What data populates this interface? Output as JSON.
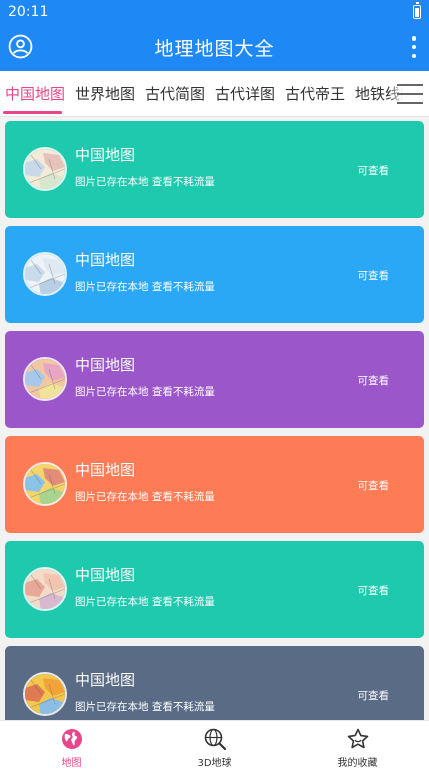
{
  "status_bar": {
    "time": "20:11"
  },
  "app_bar": {
    "title": "地理地图大全"
  },
  "tabs": [
    {
      "label": "中国地图"
    },
    {
      "label": "世界地图"
    },
    {
      "label": "古代简图"
    },
    {
      "label": "古代详图"
    },
    {
      "label": "古代帝王"
    },
    {
      "label": "地铁线路"
    }
  ],
  "colors": {
    "primary": "#1e88f5",
    "accent": "#e8458b",
    "cards": [
      "#1ec9ae",
      "#2ba8f5",
      "#9b57c9",
      "#fd7b55",
      "#1ec9ae",
      "#596b85"
    ]
  },
  "cards": [
    {
      "title": "中国地图",
      "subtitle": "图片已存在本地 查看不耗流量",
      "action": "可查看",
      "thumb_icon": "china-map-thumbnail"
    },
    {
      "title": "中国地图",
      "subtitle": "图片已存在本地 查看不耗流量",
      "action": "可查看",
      "thumb_icon": "china-map-thumbnail"
    },
    {
      "title": "中国地图",
      "subtitle": "图片已存在本地 查看不耗流量",
      "action": "可查看",
      "thumb_icon": "china-map-thumbnail"
    },
    {
      "title": "中国地图",
      "subtitle": "图片已存在本地 查看不耗流量",
      "action": "可查看",
      "thumb_icon": "china-map-thumbnail"
    },
    {
      "title": "中国地图",
      "subtitle": "图片已存在本地 查看不耗流量",
      "action": "可查看",
      "thumb_icon": "china-map-thumbnail"
    },
    {
      "title": "中国地图",
      "subtitle": "图片已存在本地 查看不耗流量",
      "action": "可查看",
      "thumb_icon": "china-map-thumbnail"
    }
  ],
  "bottom_nav": [
    {
      "label": "地图",
      "icon": "globe-icon"
    },
    {
      "label": "3D地球",
      "icon": "earth-search-icon"
    },
    {
      "label": "我的收藏",
      "icon": "star-icon"
    }
  ]
}
